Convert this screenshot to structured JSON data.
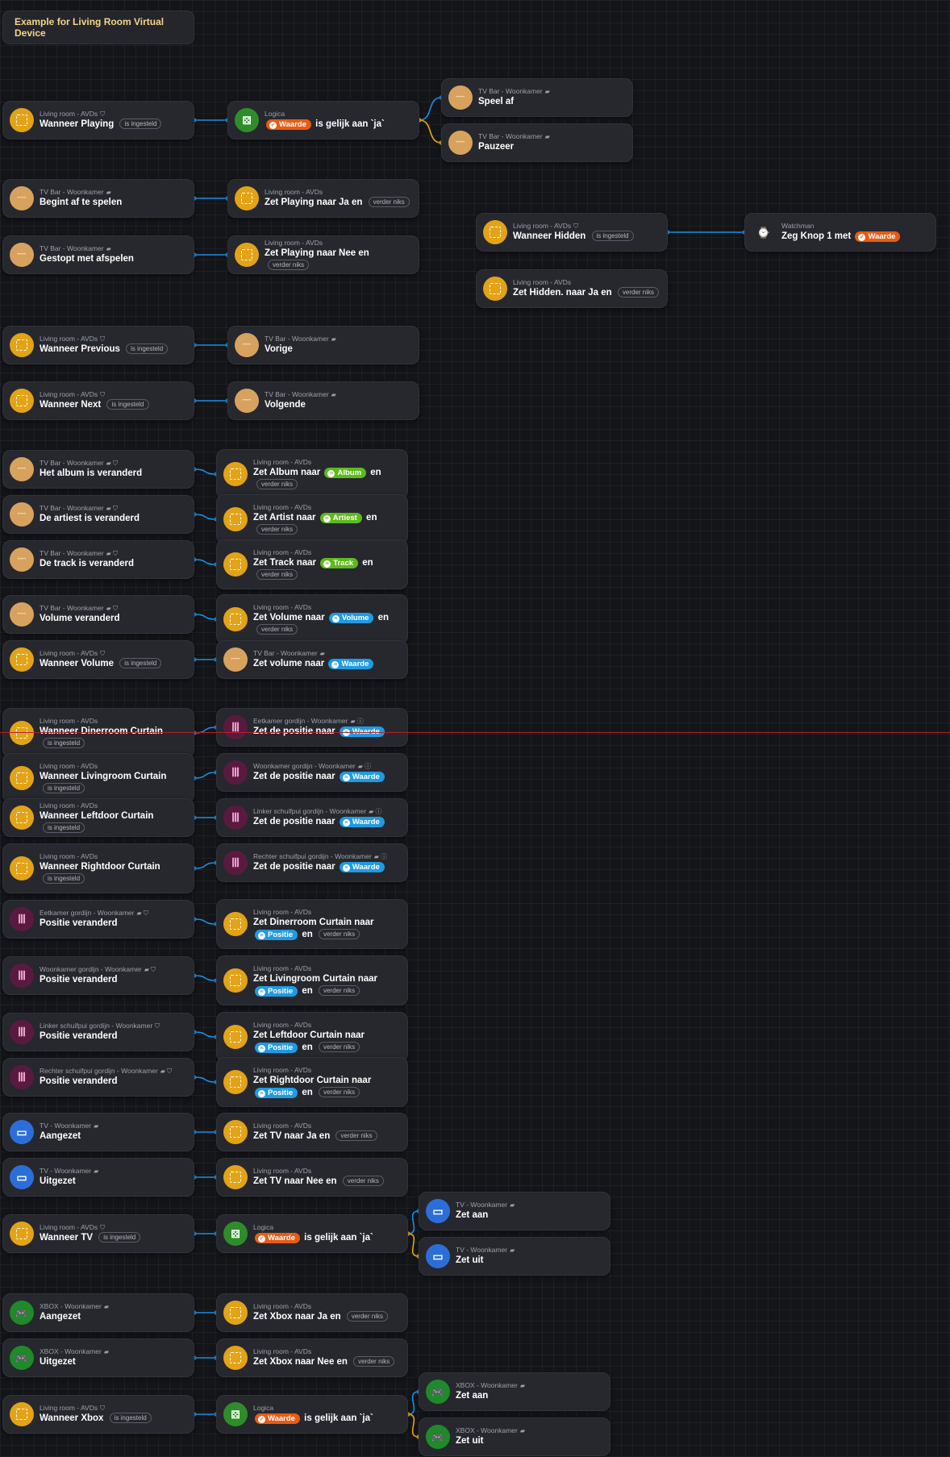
{
  "flow_title": "Example for Living Room Virtual Device",
  "icons": {
    "avd": "virtual-device-icon",
    "tvbar": "tv-bar-soundbar-icon",
    "logic": "logic-icon",
    "curtain": "curtain-icon",
    "tv": "tv-icon",
    "xbox": "gamepad-icon",
    "watchman": "watch-icon"
  },
  "colors": {
    "accent_wire": "#1a8fe3",
    "false_wire": "#e5a612",
    "token_orange": "#ea5b12",
    "token_blue": "#1f9be3",
    "token_green": "#5dba1c",
    "title_text": "#f4d58a",
    "debug_line": "#b3222a"
  },
  "tag_glyph": "⛉",
  "flag_glyph": "▰",
  "info_glyph": "ⓘ",
  "nodes": [
    {
      "id": "n1",
      "icon": "avd",
      "sub": "Living room - AVDs",
      "tag": "⛉",
      "pre": "Wanneer Playing",
      "badge": "is ingesteld"
    },
    {
      "id": "n2",
      "icon": "logic",
      "sub": "Logica",
      "tokenO": "Waarde",
      "post": "is gelijk aan `ja`"
    },
    {
      "id": "n3",
      "icon": "tvbar",
      "sub": "TV Bar - Woonkamer",
      "tag": "▰",
      "pre": "Speel af"
    },
    {
      "id": "n4",
      "icon": "tvbar",
      "sub": "TV Bar - Woonkamer",
      "tag": "▰",
      "pre": "Pauzeer"
    },
    {
      "id": "n5",
      "icon": "tvbar",
      "sub": "TV Bar - Woonkamer",
      "tag": "▰",
      "pre": "Begint af te spelen"
    },
    {
      "id": "n6",
      "icon": "avd",
      "sub": "Living room - AVDs",
      "pre": "Zet Playing naar Ja en",
      "badge": "verder niks"
    },
    {
      "id": "n7",
      "icon": "tvbar",
      "sub": "TV Bar - Woonkamer",
      "tag": "▰",
      "pre": "Gestopt met afspelen"
    },
    {
      "id": "n8",
      "icon": "avd",
      "sub": "Living room - AVDs",
      "pre": "Zet Playing naar Nee en",
      "badge": "verder niks"
    },
    {
      "id": "n9",
      "icon": "avd",
      "sub": "Living room - AVDs",
      "tag": "⛉",
      "pre": "Wanneer Hidden",
      "badge": "is ingesteld"
    },
    {
      "id": "n10",
      "icon": "watchman",
      "sub": "Watchman",
      "pre": "Zeg Knop 1 met",
      "tokenO": "Waarde"
    },
    {
      "id": "n11",
      "icon": "avd",
      "sub": "Living room - AVDs",
      "pre": "Zet Hidden. naar Ja en",
      "badge": "verder niks"
    },
    {
      "id": "n12",
      "icon": "avd",
      "sub": "Living room - AVDs",
      "tag": "⛉",
      "pre": "Wanneer Previous",
      "badge": "is ingesteld"
    },
    {
      "id": "n13",
      "icon": "tvbar",
      "sub": "TV Bar - Woonkamer",
      "tag": "▰",
      "pre": "Vorige"
    },
    {
      "id": "n14",
      "icon": "avd",
      "sub": "Living room - AVDs",
      "tag": "⛉",
      "pre": "Wanneer Next",
      "badge": "is ingesteld"
    },
    {
      "id": "n15",
      "icon": "tvbar",
      "sub": "TV Bar - Woonkamer",
      "tag": "▰",
      "pre": "Volgende"
    },
    {
      "id": "n16",
      "icon": "tvbar",
      "sub": "TV Bar - Woonkamer",
      "tag": "▰ ⛉",
      "pre": "Het album is veranderd"
    },
    {
      "id": "n17",
      "icon": "avd",
      "sub": "Living room - AVDs",
      "pre": "Zet Album naar",
      "tokenG": "Album",
      "post": "en",
      "badge": "verder niks"
    },
    {
      "id": "n18",
      "icon": "tvbar",
      "sub": "TV Bar - Woonkamer",
      "tag": "▰ ⛉",
      "pre": "De artiest is veranderd"
    },
    {
      "id": "n19",
      "icon": "avd",
      "sub": "Living room - AVDs",
      "pre": "Zet Artist naar",
      "tokenG": "Artiest",
      "post": "en",
      "badge": "verder niks"
    },
    {
      "id": "n20",
      "icon": "tvbar",
      "sub": "TV Bar - Woonkamer",
      "tag": "▰ ⛉",
      "pre": "De track is veranderd"
    },
    {
      "id": "n21",
      "icon": "avd",
      "sub": "Living room - AVDs",
      "pre": "Zet Track naar",
      "tokenG": "Track",
      "post": "en",
      "badge": "verder niks"
    },
    {
      "id": "n22",
      "icon": "tvbar",
      "sub": "TV Bar - Woonkamer",
      "tag": "▰ ⛉",
      "pre": "Volume veranderd"
    },
    {
      "id": "n23",
      "icon": "avd",
      "sub": "Living room - AVDs",
      "pre": "Zet Volume naar",
      "tokenB": "Volume",
      "post": "en",
      "badge": "verder niks"
    },
    {
      "id": "n24",
      "icon": "avd",
      "sub": "Living room - AVDs",
      "tag": "⛉",
      "pre": "Wanneer Volume",
      "badge": "is ingesteld"
    },
    {
      "id": "n25",
      "icon": "tvbar",
      "sub": "TV Bar - Woonkamer",
      "tag": "▰",
      "pre": "Zet volume naar",
      "tokenB": "Waarde"
    },
    {
      "id": "n26",
      "icon": "avd",
      "sub": "Living room - AVDs",
      "pre": "Wanneer Dinerroom Curtain",
      "badge": "is ingesteld"
    },
    {
      "id": "n27",
      "icon": "curtain",
      "sub": "Eetkamer gordijn - Woonkamer",
      "tag": "▰ ⓘ",
      "pre": "Zet de positie naar",
      "tokenB": "Waarde"
    },
    {
      "id": "n28",
      "icon": "avd",
      "sub": "Living room - AVDs",
      "pre": "Wanneer Livingroom Curtain",
      "badge": "is ingesteld"
    },
    {
      "id": "n29",
      "icon": "curtain",
      "sub": "Woonkamer gordijn - Woonkamer",
      "tag": "▰ ⓘ",
      "pre": "Zet de positie naar",
      "tokenB": "Waarde"
    },
    {
      "id": "n30",
      "icon": "avd",
      "sub": "Living room - AVDs",
      "pre": "Wanneer Leftdoor Curtain",
      "badge": "is ingesteld"
    },
    {
      "id": "n31",
      "icon": "curtain",
      "sub": "Linker schuifpui gordijn - Woonkamer",
      "tag": "▰ ⓘ",
      "pre": "Zet de positie naar",
      "tokenB": "Waarde"
    },
    {
      "id": "n32",
      "icon": "avd",
      "sub": "Living room - AVDs",
      "pre": "Wanneer Rightdoor Curtain",
      "badge": "is ingesteld"
    },
    {
      "id": "n33",
      "icon": "curtain",
      "sub": "Rechter schuifpui gordijn - Woonkamer",
      "tag": "▰ ⓘ",
      "pre": "Zet de positie naar",
      "tokenB": "Waarde"
    },
    {
      "id": "n34",
      "icon": "curtain",
      "sub": "Eetkamer gordijn - Woonkamer",
      "tag": "▰ ⛉",
      "pre": "Positie veranderd"
    },
    {
      "id": "n35",
      "icon": "avd",
      "sub": "Living room - AVDs",
      "pre": "Zet Dinerroom Curtain naar",
      "tokenB": "Positie",
      "post": "en",
      "badge": "verder niks"
    },
    {
      "id": "n36",
      "icon": "curtain",
      "sub": "Woonkamer gordijn - Woonkamer",
      "tag": "▰ ⛉",
      "pre": "Positie veranderd"
    },
    {
      "id": "n37",
      "icon": "avd",
      "sub": "Living room - AVDs",
      "pre": "Zet Livingroom Curtain naar",
      "tokenB": "Positie",
      "post": "en",
      "badge": "verder niks"
    },
    {
      "id": "n38",
      "icon": "curtain",
      "sub": "Linker schuifpui gordijn - Woonkamer",
      "tag": "⛉",
      "pre": "Positie veranderd"
    },
    {
      "id": "n39",
      "icon": "avd",
      "sub": "Living room - AVDs",
      "pre": "Zet Leftdoor Curtain naar",
      "tokenB": "Positie",
      "post": "en",
      "badge": "verder niks"
    },
    {
      "id": "n40",
      "icon": "curtain",
      "sub": "Rechter schuifpui gordijn - Woonkamer",
      "tag": "▰ ⛉",
      "pre": "Positie veranderd"
    },
    {
      "id": "n41",
      "icon": "avd",
      "sub": "Living room - AVDs",
      "pre": "Zet Rightdoor Curtain naar",
      "tokenB": "Positie",
      "post": "en",
      "badge": "verder niks"
    },
    {
      "id": "n42",
      "icon": "tv",
      "sub": "TV - Woonkamer",
      "tag": "▰",
      "pre": "Aangezet"
    },
    {
      "id": "n43",
      "icon": "avd",
      "sub": "Living room - AVDs",
      "pre": "Zet TV naar Ja en",
      "badge": "verder niks"
    },
    {
      "id": "n44",
      "icon": "tv",
      "sub": "TV - Woonkamer",
      "tag": "▰",
      "pre": "Uitgezet"
    },
    {
      "id": "n45",
      "icon": "avd",
      "sub": "Living room - AVDs",
      "pre": "Zet TV naar Nee en",
      "badge": "verder niks"
    },
    {
      "id": "n46",
      "icon": "avd",
      "sub": "Living room - AVDs",
      "tag": "⛉",
      "pre": "Wanneer TV",
      "badge": "is ingesteld"
    },
    {
      "id": "n47",
      "icon": "logic",
      "sub": "Logica",
      "tokenO": "Waarde",
      "post": "is gelijk aan `ja`"
    },
    {
      "id": "n48",
      "icon": "tv",
      "sub": "TV - Woonkamer",
      "tag": "▰",
      "pre": "Zet aan"
    },
    {
      "id": "n49",
      "icon": "tv",
      "sub": "TV - Woonkamer",
      "tag": "▰",
      "pre": "Zet uit"
    },
    {
      "id": "n50",
      "icon": "xbox",
      "sub": "XBOX - Woonkamer",
      "tag": "▰",
      "pre": "Aangezet"
    },
    {
      "id": "n51",
      "icon": "avd",
      "sub": "Living room - AVDs",
      "pre": "Zet Xbox naar Ja en",
      "badge": "verder niks"
    },
    {
      "id": "n52",
      "icon": "xbox",
      "sub": "XBOX - Woonkamer",
      "tag": "▰",
      "pre": "Uitgezet"
    },
    {
      "id": "n53",
      "icon": "avd",
      "sub": "Living room - AVDs",
      "pre": "Zet Xbox naar Nee en",
      "badge": "verder niks"
    },
    {
      "id": "n54",
      "icon": "avd",
      "sub": "Living room - AVDs",
      "tag": "⛉",
      "pre": "Wanneer Xbox",
      "badge": "is ingesteld"
    },
    {
      "id": "n55",
      "icon": "logic",
      "sub": "Logica",
      "tokenO": "Waarde",
      "post": "is gelijk aan `ja`"
    },
    {
      "id": "n56",
      "icon": "xbox",
      "sub": "XBOX - Woonkamer",
      "tag": "▰",
      "pre": "Zet aan"
    },
    {
      "id": "n57",
      "icon": "xbox",
      "sub": "XBOX - Woonkamer",
      "tag": "▰",
      "pre": "Zet uit"
    }
  ],
  "connections": [
    {
      "from": "n1",
      "to": "n2"
    },
    {
      "from": "n2",
      "to": "n3"
    },
    {
      "from": "n2",
      "to": "n4",
      "kind": "false"
    },
    {
      "from": "n5",
      "to": "n6"
    },
    {
      "from": "n7",
      "to": "n8"
    },
    {
      "from": "n9",
      "to": "n10"
    },
    {
      "from": "n12",
      "to": "n13"
    },
    {
      "from": "n14",
      "to": "n15"
    },
    {
      "from": "n16",
      "to": "n17"
    },
    {
      "from": "n18",
      "to": "n19"
    },
    {
      "from": "n20",
      "to": "n21"
    },
    {
      "from": "n22",
      "to": "n23"
    },
    {
      "from": "n24",
      "to": "n25"
    },
    {
      "from": "n26",
      "to": "n27"
    },
    {
      "from": "n28",
      "to": "n29"
    },
    {
      "from": "n30",
      "to": "n31"
    },
    {
      "from": "n32",
      "to": "n33"
    },
    {
      "from": "n34",
      "to": "n35"
    },
    {
      "from": "n36",
      "to": "n37"
    },
    {
      "from": "n38",
      "to": "n39"
    },
    {
      "from": "n40",
      "to": "n41"
    },
    {
      "from": "n42",
      "to": "n43"
    },
    {
      "from": "n44",
      "to": "n45"
    },
    {
      "from": "n46",
      "to": "n47"
    },
    {
      "from": "n47",
      "to": "n48"
    },
    {
      "from": "n47",
      "to": "n49",
      "kind": "false"
    },
    {
      "from": "n50",
      "to": "n51"
    },
    {
      "from": "n52",
      "to": "n53"
    },
    {
      "from": "n54",
      "to": "n55"
    },
    {
      "from": "n55",
      "to": "n56"
    },
    {
      "from": "n55",
      "to": "n57",
      "kind": "false"
    }
  ]
}
